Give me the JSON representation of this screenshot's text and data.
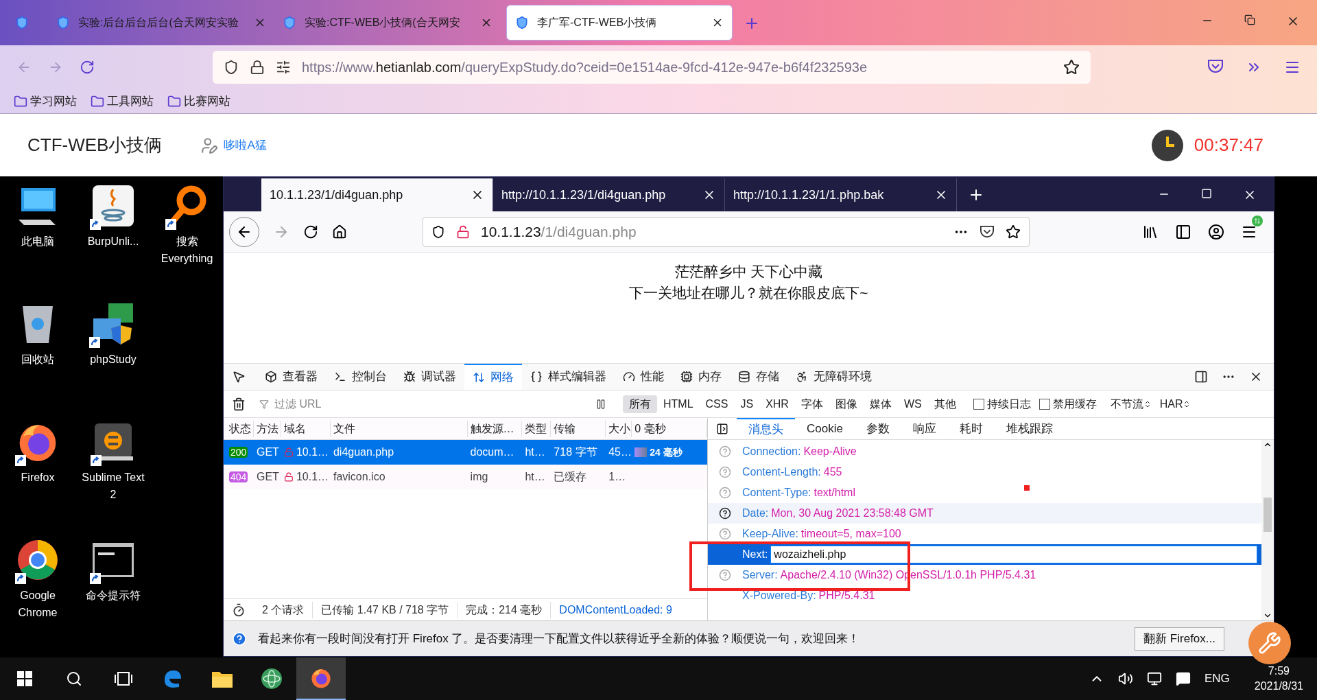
{
  "browser": {
    "tabs": [
      {
        "kind": "pinned",
        "selected": false
      },
      {
        "kind": "tab",
        "title": "实验:后台后台后台(合天网安实验",
        "selected": false
      },
      {
        "kind": "tab",
        "title": "实验:CTF-WEB小技俩(合天网安",
        "selected": false
      },
      {
        "kind": "tab",
        "title": "李广军-CTF-WEB小技俩",
        "selected": true
      }
    ],
    "url_prefix": "https://www.",
    "url_domain": "hetianlab.com",
    "url_rest": "/queryExpStudy.do?ceid=0e1514ae-9fcd-412e-947e-b6f4f232593e",
    "bookmarks": [
      "学习网站",
      "工具网站",
      "比赛网站"
    ]
  },
  "site_header": {
    "title": "CTF-WEB小技俩",
    "user": "哆啦A猛",
    "timer": "00:37:47"
  },
  "desktop": {
    "columns": [
      [
        {
          "kind": "computer",
          "label": "此电脑",
          "shortcut": false
        },
        {
          "kind": "recycle",
          "label": "回收站",
          "shortcut": false
        },
        {
          "kind": "firefox",
          "label": "Firefox",
          "shortcut": true
        },
        {
          "kind": "chrome",
          "label": "Google Chrome",
          "shortcut": true
        }
      ],
      [
        {
          "kind": "java",
          "label": "BurpUnli...",
          "shortcut": true
        },
        {
          "kind": "phpstudy",
          "label": "phpStudy",
          "shortcut": true
        },
        {
          "kind": "sublime",
          "label": "Sublime Text 2",
          "shortcut": true
        },
        {
          "kind": "cmd",
          "label": "命令提示符",
          "shortcut": true
        }
      ],
      [
        {
          "kind": "search",
          "label": "搜索 Everything",
          "shortcut": true
        }
      ]
    ]
  },
  "inner_browser": {
    "tabs": [
      {
        "title": "10.1.1.23/1/di4guan.php",
        "selected": true
      },
      {
        "title": "http://10.1.1.23/1/di4guan.php",
        "selected": false
      },
      {
        "title": "http://10.1.1.23/1/1.php.bak",
        "selected": false
      }
    ],
    "url_host": "10.1.1.23",
    "url_path": "/1/di4guan.php",
    "page_lines": [
      "茫茫醉乡中 天下心中藏",
      "下一关地址在哪儿？就在你眼皮底下~"
    ]
  },
  "devtools": {
    "tools": [
      {
        "kind": "inspector",
        "label": "查看器",
        "selected": false
      },
      {
        "kind": "console",
        "label": "控制台",
        "selected": false
      },
      {
        "kind": "debugger",
        "label": "调试器",
        "selected": false
      },
      {
        "kind": "network",
        "label": "网络",
        "selected": true
      },
      {
        "kind": "style",
        "label": "样式编辑器",
        "selected": false
      },
      {
        "kind": "performance",
        "label": "性能",
        "selected": false
      },
      {
        "kind": "memory",
        "label": "内存",
        "selected": false
      },
      {
        "kind": "storage",
        "label": "存储",
        "selected": false
      },
      {
        "kind": "accessibility",
        "label": "无障碍环境",
        "selected": false
      }
    ],
    "filter_placeholder": "过滤 URL",
    "type_filters": [
      {
        "label": "所有",
        "selected": true
      },
      {
        "label": "HTML",
        "selected": false
      },
      {
        "label": "CSS",
        "selected": false
      },
      {
        "label": "JS",
        "selected": false
      },
      {
        "label": "XHR",
        "selected": false
      },
      {
        "label": "字体",
        "selected": false
      },
      {
        "label": "图像",
        "selected": false
      },
      {
        "label": "媒体",
        "selected": false
      },
      {
        "label": "WS",
        "selected": false
      },
      {
        "label": "其他",
        "selected": false
      }
    ],
    "checkboxes": [
      {
        "label": "持续日志",
        "checked": false
      },
      {
        "label": "禁用缓存",
        "checked": false
      }
    ],
    "throttle": "不节流",
    "har": "HAR",
    "columns": [
      "状态",
      "方法",
      "域名",
      "文件",
      "触发源…",
      "类型",
      "传输",
      "大小",
      "0 毫秒"
    ],
    "rows": [
      {
        "status": "200",
        "color": "#058b00",
        "method": "GET",
        "domain": "10.1…",
        "file": "di4guan.php",
        "initiator": "docum…",
        "type": "ht…",
        "transferred": "718 字节",
        "size": "45…",
        "timing": "24 毫秒",
        "selected": true
      },
      {
        "status": "404",
        "color": "#c35be3",
        "method": "GET",
        "domain": "10.1…",
        "file": "favicon.ico",
        "initiator": "img",
        "type": "ht…",
        "transferred": "已缓存",
        "size": "1…",
        "timing": "",
        "selected": false
      }
    ],
    "summary": [
      "2 个请求",
      "已传输 1.47 KB / 718 字节",
      "完成：214 毫秒"
    ],
    "summary_link": "DOMContentLoaded: 9",
    "detail_tabs": [
      {
        "label": "消息头",
        "selected": true
      },
      {
        "label": "Cookie",
        "selected": false
      },
      {
        "label": "参数",
        "selected": false
      },
      {
        "label": "响应",
        "selected": false
      },
      {
        "label": "耗时",
        "selected": false
      },
      {
        "label": "堆栈跟踪",
        "selected": false
      }
    ],
    "headers": [
      {
        "name": "Connection:",
        "value": "Keep-Alive",
        "help_icon": true,
        "hovered": false,
        "selected": false
      },
      {
        "name": "Content-Length:",
        "value": "455",
        "help_icon": true,
        "hovered": false,
        "selected": false
      },
      {
        "name": "Content-Type:",
        "value": "text/html",
        "help_icon": true,
        "hovered": false,
        "selected": false
      },
      {
        "name": "Date:",
        "value": "Mon, 30 Aug 2021 23:58:48 GMT",
        "help_icon": true,
        "hovered": true,
        "selected": false
      },
      {
        "name": "Keep-Alive:",
        "value": "timeout=5, max=100",
        "help_icon": true,
        "hovered": false,
        "selected": false
      },
      {
        "name": "Next:",
        "value": "wozaizheli.php",
        "help_icon": false,
        "hovered": false,
        "selected": true
      },
      {
        "name": "Server:",
        "value": "Apache/2.4.10 (Win32) OpenSSL/1.0.1h PHP/5.4.31",
        "help_icon": true,
        "hovered": false,
        "selected": false
      },
      {
        "name": "X-Powered-By:",
        "value": "PHP/5.4.31",
        "help_icon": false,
        "hovered": false,
        "selected": false
      }
    ]
  },
  "notification": {
    "text": "看起来你有一段时间没有打开 Firefox 了。是否要清理一下配置文件以获得近乎全新的体验？顺便说一句，欢迎回来！",
    "button": "翻新 Firefox..."
  },
  "taskbar": {
    "apps": [
      {
        "kind": "edge",
        "selected": false
      },
      {
        "kind": "folder",
        "selected": false
      },
      {
        "kind": "atom",
        "selected": false
      },
      {
        "kind": "firefox",
        "selected": true
      }
    ],
    "language": "ENG",
    "time": "7:59",
    "date": "2021/8/31"
  }
}
